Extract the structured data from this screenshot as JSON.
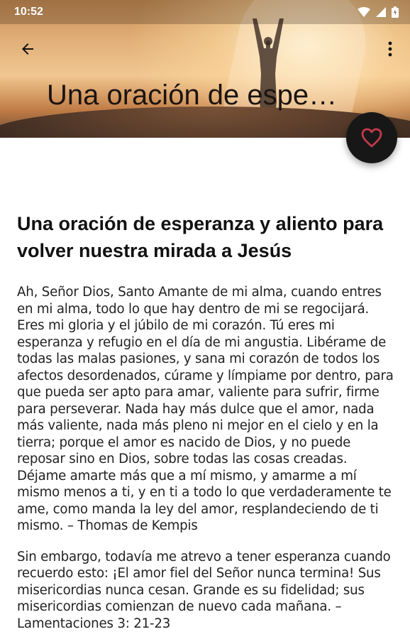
{
  "status_bar": {
    "time": "10:52"
  },
  "toolbar": {
    "title": "Una oración de espe…",
    "back_icon": "arrow-back-icon",
    "menu_icon": "more-vert-icon"
  },
  "fab": {
    "icon": "heart-outline-icon",
    "accent_color": "#c23a4b"
  },
  "article": {
    "title": "Una oración de esperanza y aliento para volver nuestra mirada a Jesús",
    "paragraphs": [
      "Ah, Señor Dios, Santo Amante de mi alma, cuando entres en mi alma, todo lo que hay dentro de mi se regocijará. Eres mi gloria y el júbilo de mi corazón. Tú eres mi esperanza y refugio en el día de mi angustia. Libérame de todas las malas pasiones, y sana mi corazón de todos los afectos desordenados, cúrame y límpiame por dentro, para que pueda ser apto para amar, valiente para sufrir, firme para perseverar. Nada hay más dulce que el amor, nada más valiente, nada más pleno ni mejor en el cielo y en la tierra; porque el amor es nacido de Dios, y no puede reposar sino en Dios, sobre todas las cosas creadas. Déjame amarte más que a mí mismo, y amarme a mí mismo menos a ti, y en ti a todo lo que verdaderamente te ame, como manda la ley del amor, resplandeciendo de ti mismo. – Thomas de Kempis",
      "Sin embargo, todavía me atrevo a tener esperanza cuando recuerdo esto: ¡El amor fiel del Señor nunca termina! Sus misericordias nunca cesan. Grande es su fidelidad; sus misericordias comienzan de nuevo cada mañana. – Lamentaciones 3: 21-23"
    ]
  }
}
